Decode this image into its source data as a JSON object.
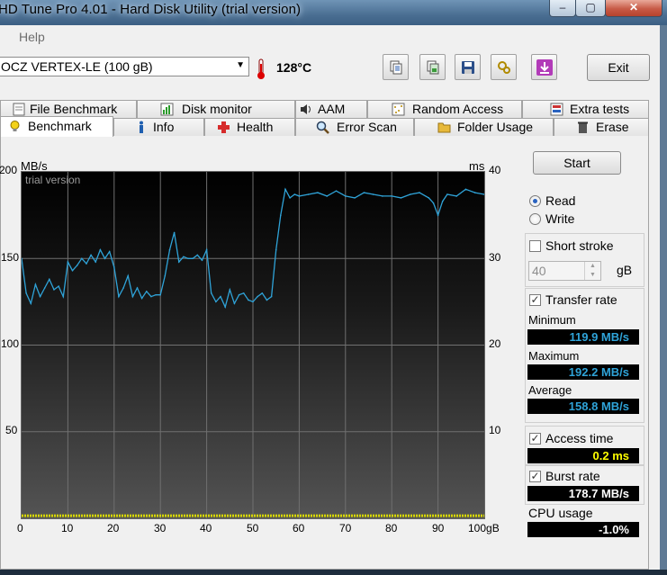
{
  "window": {
    "title": "HD Tune Pro 4.01 - Hard Disk Utility (trial version)",
    "controls": {
      "minimize": "–",
      "maximize": "▢",
      "close": "✕"
    }
  },
  "menu": {
    "help": "Help"
  },
  "toolbar": {
    "drive": "OCZ VERTEX-LE (100 gB)",
    "temperature": "128°C",
    "buttons": [
      "copy-text-icon",
      "copy-screenshot-icon",
      "save-icon",
      "options-icon",
      "download-icon"
    ],
    "exit_label": "Exit"
  },
  "tabs": {
    "top_row": [
      "File Benchmark",
      "Disk monitor",
      "AAM",
      "Random Access",
      "Extra tests"
    ],
    "bottom_row": [
      "Benchmark",
      "Info",
      "Health",
      "Error Scan",
      "Folder Usage",
      "Erase"
    ],
    "active": "Benchmark"
  },
  "chart": {
    "y_left_unit": "MB/s",
    "y_right_unit": "ms",
    "watermark": "trial version",
    "y_left_ticks": [
      "200",
      "150",
      "100",
      "50"
    ],
    "y_right_ticks": [
      "40",
      "30",
      "20",
      "10"
    ],
    "x_ticks": [
      "0",
      "10",
      "20",
      "30",
      "40",
      "50",
      "60",
      "70",
      "80",
      "90",
      "100gB"
    ]
  },
  "chart_data": {
    "type": "line",
    "xlim": [
      0,
      100
    ],
    "ylim": [
      0,
      200
    ],
    "y2lim": [
      0,
      40
    ],
    "grid": true,
    "series": [
      {
        "color": "#2fa3d8",
        "x": [
          0,
          1,
          2,
          3,
          4,
          5,
          6,
          7,
          8,
          9,
          10,
          11,
          12,
          13,
          14,
          15,
          16,
          17,
          18,
          19,
          20,
          21,
          22,
          23,
          24,
          25,
          26,
          27,
          28,
          29,
          30,
          31,
          32,
          33,
          34,
          35,
          36,
          37,
          38,
          39,
          40,
          41,
          42,
          43,
          44,
          45,
          46,
          47,
          48,
          49,
          50,
          51,
          52,
          53,
          54,
          55,
          56,
          57,
          58,
          59,
          60,
          62,
          64,
          66,
          68,
          70,
          72,
          74,
          76,
          78,
          80,
          82,
          84,
          86,
          88,
          89,
          90,
          91,
          92,
          94,
          96,
          98,
          100
        ],
        "values": [
          150,
          130,
          124,
          135,
          128,
          133,
          138,
          132,
          134,
          128,
          148,
          143,
          146,
          150,
          147,
          152,
          148,
          155,
          150,
          154,
          145,
          128,
          133,
          140,
          128,
          133,
          127,
          131,
          128,
          129,
          129,
          140,
          155,
          165,
          148,
          151,
          150,
          150,
          152,
          149,
          155,
          130,
          125,
          128,
          122,
          132,
          124,
          129,
          130,
          126,
          125,
          128,
          130,
          126,
          128,
          155,
          175,
          190,
          185,
          187,
          186,
          187,
          188,
          186,
          189,
          186,
          185,
          188,
          187,
          186,
          186,
          185,
          187,
          188,
          185,
          182,
          175,
          183,
          187,
          186,
          190,
          188,
          187
        ]
      },
      {
        "color": "#d8d800",
        "x": [
          0,
          100
        ],
        "values": [
          0.2,
          0.2
        ],
        "axis": "right"
      }
    ]
  },
  "controls": {
    "start_label": "Start",
    "read_label": "Read",
    "write_label": "Write",
    "mode": "Read",
    "short_stroke_label": "Short stroke",
    "short_stroke_checked": false,
    "short_stroke_value": "40",
    "short_stroke_unit": "gB",
    "transfer_rate_label": "Transfer rate",
    "transfer_rate_checked": true,
    "access_time_label": "Access time",
    "access_time_checked": true,
    "burst_rate_label": "Burst rate",
    "burst_rate_checked": true
  },
  "stats": {
    "minimum_label": "Minimum",
    "minimum_value": "119.9 MB/s",
    "maximum_label": "Maximum",
    "maximum_value": "192.2 MB/s",
    "average_label": "Average",
    "average_value": "158.8 MB/s",
    "access_time_value": "0.2 ms",
    "burst_rate_value": "178.7 MB/s",
    "cpu_usage_label": "CPU usage",
    "cpu_usage_value": "-1.0%",
    "colors": {
      "transfer": "#2fa3d8",
      "access": "#ffff00",
      "burst": "#ffffff",
      "cpu": "#ffffff"
    }
  }
}
